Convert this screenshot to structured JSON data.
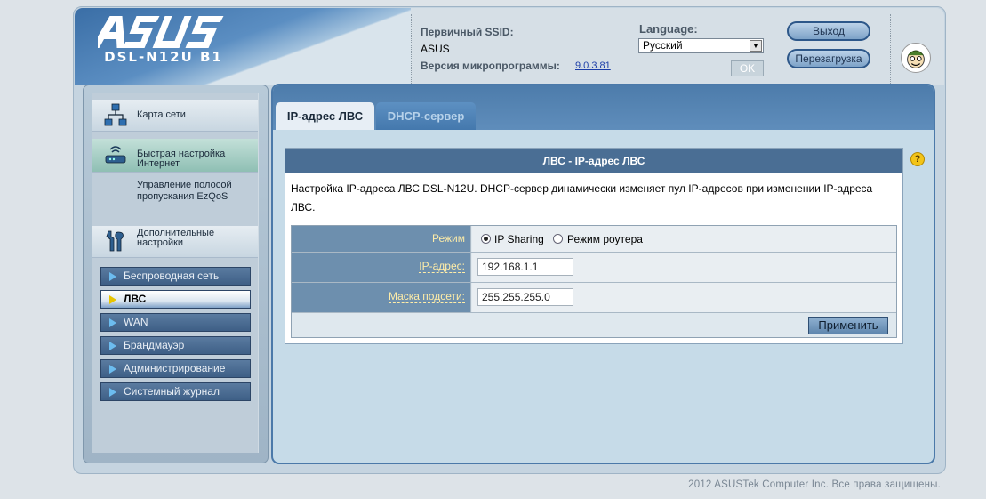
{
  "header": {
    "brand": "ASUS",
    "model": "DSL-N12U B1",
    "ssid_label": "Первичный SSID:",
    "ssid_value": "ASUS",
    "firmware_label": "Версия микропрограммы:",
    "firmware_value": "9.0.3.81",
    "language_label": "Language:",
    "language_value": "Русский",
    "ok_label": "OK",
    "logout_label": "Выход",
    "reboot_label": "Перезагрузка"
  },
  "menu": {
    "items": [
      {
        "label": "Карта сети",
        "icon": "network-map-icon"
      },
      {
        "label": "Быстрая настройка Интернет",
        "icon": "router-icon"
      },
      {
        "label": "Управление полосой пропускания EzQoS"
      },
      {
        "label": "Дополнительные настройки",
        "icon": "tools-icon"
      }
    ],
    "subitems": [
      {
        "label": "Беспроводная сеть"
      },
      {
        "label": "ЛВС"
      },
      {
        "label": "WAN"
      },
      {
        "label": "Брандмауэр"
      },
      {
        "label": "Администрирование"
      },
      {
        "label": "Системный журнал"
      }
    ]
  },
  "tabs": [
    {
      "label": "IP-адрес ЛВС",
      "active": true
    },
    {
      "label": "DHCP-сервер",
      "active": false
    }
  ],
  "panel": {
    "title": "ЛВС - IP-адрес ЛВС",
    "description": "Настройка IP-адреса ЛВС DSL-N12U. DHCP-сервер динамически изменяет пул IP-адресов при изменении IP-адреса ЛВС.",
    "mode_label": "Режим",
    "mode_option_1": "IP Sharing",
    "mode_option_2": "Режим роутера",
    "mode_selected": "IP Sharing",
    "ip_label": "IP-адрес:",
    "ip_value": "192.168.1.1",
    "mask_label": "Маска подсети:",
    "mask_value": "255.255.255.0",
    "apply_label": "Применить",
    "help_symbol": "?"
  },
  "footer": {
    "copyright": "2012 ASUSTek Computer Inc. Все права защищены."
  },
  "colors": {
    "accent": "#4a6e94",
    "menu_active": "#8fbfb4",
    "label_text": "#ffeda8"
  }
}
